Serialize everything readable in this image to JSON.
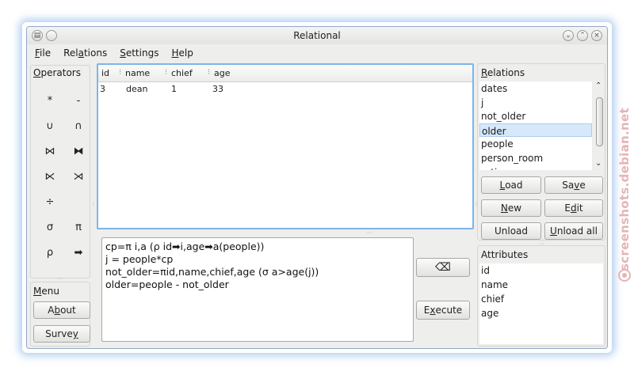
{
  "window": {
    "title": "Relational"
  },
  "menubar": [
    {
      "pre": "",
      "key": "F",
      "post": "ile"
    },
    {
      "pre": "Rel",
      "key": "a",
      "post": "tions"
    },
    {
      "pre": "",
      "key": "S",
      "post": "ettings"
    },
    {
      "pre": "",
      "key": "H",
      "post": "elp"
    }
  ],
  "operators": {
    "label_key": "O",
    "label_rest": "perators",
    "buttons": [
      "*",
      "-",
      "∪",
      "∩",
      "⋈",
      "⧓",
      "⋉",
      "⋊",
      "÷",
      "",
      "σ",
      "π",
      "ρ",
      "➡"
    ]
  },
  "menu_panel": {
    "label_key": "M",
    "label_rest": "enu",
    "about_pre": "A",
    "about_key": "b",
    "about_post": "out",
    "survey_pre": "Surve",
    "survey_key": "y",
    "survey_post": ""
  },
  "table": {
    "columns": [
      "id",
      "name",
      "chief",
      "age"
    ],
    "rows": [
      [
        "3",
        "dean",
        "1",
        "33"
      ]
    ]
  },
  "query": {
    "lines": [
      "cp=π i,a (ρ id➡i,age➡a(people))",
      "j = people*cp",
      "not_older=πid,name,chief,age (σ a>age(j))",
      "older=people - not_older"
    ]
  },
  "actions": {
    "clear_icon": "backspace-icon",
    "clear_glyph": "⌫",
    "execute_key": "x",
    "execute_pre": "E",
    "execute_post": "ecute"
  },
  "relations": {
    "label_key": "R",
    "label_rest": "elations",
    "items": [
      "dates",
      "j",
      "not_older",
      "older",
      "people",
      "person_room",
      "ratings"
    ],
    "selected_index": 3,
    "buttons": {
      "load_key": "L",
      "load_rest": "oad",
      "save_pre": "Sa",
      "save_key": "v",
      "save_post": "e",
      "new_key": "N",
      "new_rest": "ew",
      "edit_pre": "E",
      "edit_key": "d",
      "edit_post": "it",
      "unload": "Unload",
      "unload_all_key": "U",
      "unload_all_rest": "nload all"
    }
  },
  "attributes": {
    "label": "Attributes",
    "items": [
      "id",
      "name",
      "chief",
      "age"
    ]
  },
  "watermark": "screenshots.debian.net",
  "colors": {
    "accent": "#7eb4ea",
    "selection": "#d6e8fa",
    "watermark": "#e6b4b4"
  }
}
